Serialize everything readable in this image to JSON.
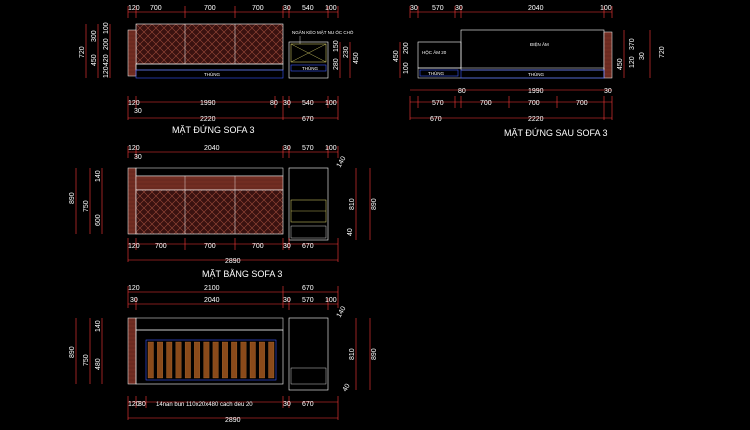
{
  "colors": {
    "background": "#000000",
    "line": "#ffffff",
    "dimension": "#ff3a3a",
    "wood": "#5a1e1a",
    "wood_pattern": "#9a4a3a",
    "cushion": "#6b2a20",
    "slat": "#8a4a1a",
    "blue_line": "#3a58ff",
    "yellow_line": "#e8e070"
  },
  "titles": {
    "front": "MẶT ĐỨNG SOFA 3",
    "back": "MẶT ĐỨNG SAU SOFA 3",
    "plan": "MẶT BẰNG SOFA 3"
  },
  "labels": {
    "drawer": "NGĂN KÉO MẶT NU ÓC CHÓ",
    "thung": "THÙNG",
    "hoc_am": "HỘC ÂM 20",
    "dien_am": "ĐIỆN ÂM",
    "slat_note": "14nan bun 110x20x480 cach deu 20"
  },
  "front": {
    "top_dims": [
      "120",
      "700",
      "700",
      "700",
      "30",
      "540",
      "100"
    ],
    "bottom_dims": [
      "120",
      "1990",
      "80",
      "30",
      "540",
      "100"
    ],
    "total_left": "2220",
    "total_right": "670",
    "sub": "30",
    "left_v": [
      "720",
      "300",
      "100",
      "200",
      "450",
      "420",
      "120"
    ],
    "mid_v": [
      "150",
      "280",
      "230",
      "450"
    ],
    "right_v": [
      "30",
      "720"
    ]
  },
  "back": {
    "top_dims": [
      "30",
      "570",
      "30",
      "2040",
      "100"
    ],
    "bottom_dims": [
      "80",
      "1990",
      "30"
    ],
    "bottom_dims2": [
      "570",
      "700",
      "700",
      "700"
    ],
    "total": "2220",
    "total_left": "670",
    "left_v": [
      "450",
      "200",
      "100"
    ],
    "right_v": [
      "370",
      "120",
      "720",
      "450",
      "30"
    ]
  },
  "plan": {
    "top_dims": [
      "120",
      "2040",
      "30",
      "570",
      "100"
    ],
    "sub": "30",
    "bottom_dims": [
      "120",
      "700",
      "700",
      "700",
      "30",
      "670"
    ],
    "total": "2890",
    "left_v": [
      "890",
      "750",
      "600",
      "140"
    ],
    "right_v": [
      "140",
      "810",
      "890",
      "40"
    ]
  },
  "plan2": {
    "top_dims1": [
      "120",
      "2100",
      "670"
    ],
    "top_dims2": [
      "30",
      "2040",
      "30",
      "570",
      "100"
    ],
    "bottom_dims": [
      "120",
      "30",
      "30",
      "670"
    ],
    "total": "2890",
    "left_v": [
      "890",
      "750",
      "480",
      "140"
    ],
    "right_v": [
      "140",
      "810",
      "890",
      "40"
    ]
  }
}
